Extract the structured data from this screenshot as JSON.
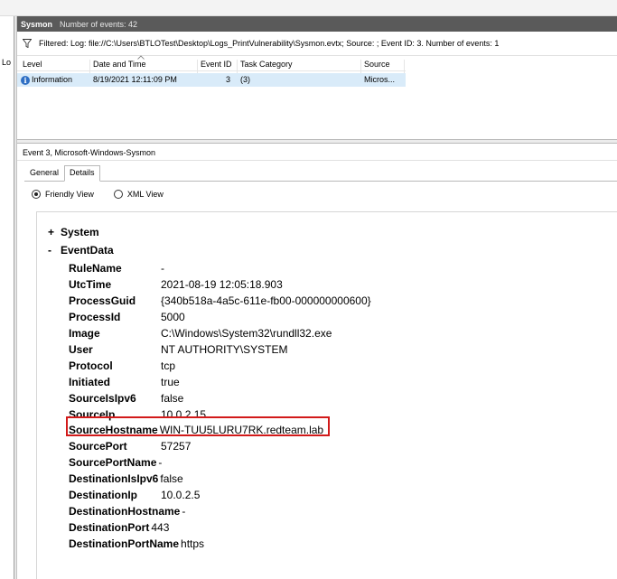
{
  "window": {
    "title": "Sysmon",
    "event_count_text": "Number of events: 42",
    "left_pane_fragment": "Lo"
  },
  "filter": {
    "text": "Filtered: Log: file://C:\\Users\\BTLOTest\\Desktop\\Logs_PrintVulnerability\\Sysmon.evtx; Source: ; Event ID: 3. Number of events: 1"
  },
  "list": {
    "columns": [
      "Level",
      "Date and Time",
      "Event ID",
      "Task Category",
      "Source"
    ],
    "rows": [
      {
        "level": "Information",
        "date_time": "8/19/2021 12:11:09 PM",
        "event_id": "3",
        "task_category": "(3)",
        "source": "Micros..."
      }
    ]
  },
  "detail": {
    "title": "Event 3, Microsoft-Windows-Sysmon",
    "tabs": [
      {
        "label": "General",
        "active": false
      },
      {
        "label": "Details",
        "active": true
      }
    ],
    "views": [
      {
        "label": "Friendly View",
        "selected": true
      },
      {
        "label": "XML View",
        "selected": false
      }
    ],
    "tree": {
      "system": {
        "sign": "+",
        "label": "System"
      },
      "eventdata": {
        "sign": "-",
        "label": "EventData"
      }
    },
    "fields": [
      {
        "key": "RuleName",
        "value": "-"
      },
      {
        "key": "UtcTime",
        "value": "2021-08-19 12:05:18.903"
      },
      {
        "key": "ProcessGuid",
        "value": "{340b518a-4a5c-611e-fb00-000000000600}"
      },
      {
        "key": "ProcessId",
        "value": "5000"
      },
      {
        "key": "Image",
        "value": "C:\\Windows\\System32\\rundll32.exe"
      },
      {
        "key": "User",
        "value": "NT AUTHORITY\\SYSTEM"
      },
      {
        "key": "Protocol",
        "value": "tcp"
      },
      {
        "key": "Initiated",
        "value": "true"
      },
      {
        "key": "SourceIsIpv6",
        "value": "false"
      },
      {
        "key": "SourceIp",
        "value": "10.0.2.15"
      },
      {
        "key": "SourceHostname",
        "value": "WIN-TUU5LURU7RK.redteam.lab"
      },
      {
        "key": "SourcePort",
        "value": "57257"
      },
      {
        "key": "SourcePortName",
        "value": "-"
      },
      {
        "key": "DestinationIsIpv6",
        "value": "false"
      },
      {
        "key": "DestinationIp",
        "value": "10.0.2.5"
      },
      {
        "key": "DestinationHostname",
        "value": "-"
      },
      {
        "key": "DestinationPort",
        "value": "443"
      },
      {
        "key": "DestinationPortName",
        "value": "https"
      }
    ]
  },
  "colors": {
    "title_bar": "#5a5a5a",
    "selected_row": "#d9ebf9",
    "highlight_box": "#d21a1a",
    "info_icon": "#2f6fc4"
  }
}
